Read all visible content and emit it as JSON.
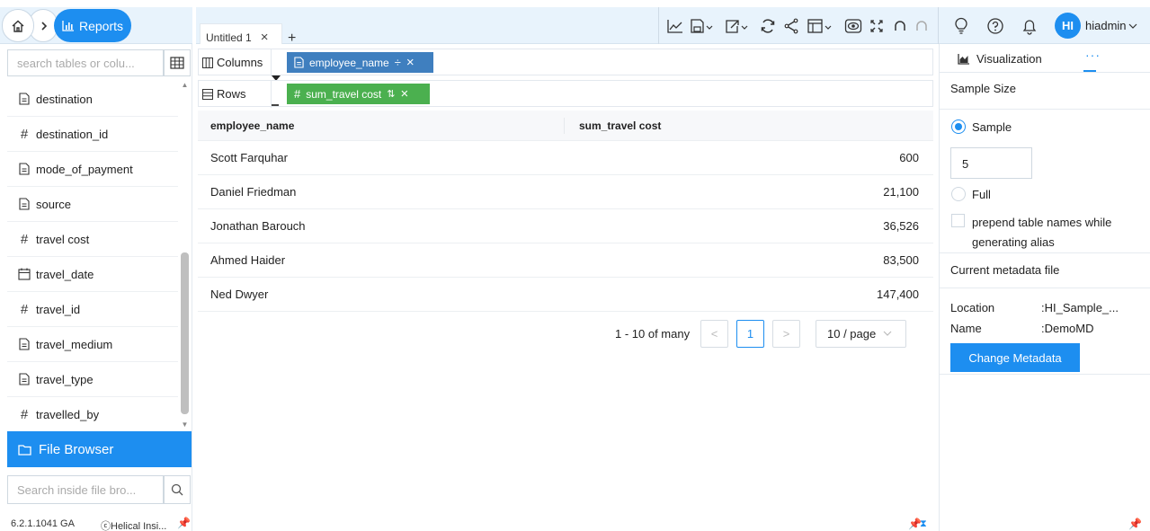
{
  "header": {
    "breadcrumb_reports": "Reports",
    "tab": {
      "title": "Untitled 1",
      "close": "×"
    },
    "add_tab": "+",
    "toolbar_icons": [
      "line-chart-icon",
      "save-dropdown-icon",
      "export-dropdown-icon",
      "refresh-icon",
      "share-icon",
      "layout-dropdown-icon",
      "preview-icon",
      "fullscreen-icon",
      "undo-icon",
      "redo-icon"
    ],
    "user": {
      "initials": "HI",
      "name": "hiadmin"
    }
  },
  "left_panel": {
    "search_placeholder": "search tables or colu...",
    "fields": [
      {
        "icon": "text-icon",
        "name": "destination"
      },
      {
        "icon": "hash-icon",
        "name": "destination_id"
      },
      {
        "icon": "text-icon",
        "name": "mode_of_payment"
      },
      {
        "icon": "text-icon",
        "name": "source"
      },
      {
        "icon": "hash-icon",
        "name": "travel cost"
      },
      {
        "icon": "calendar-icon",
        "name": "travel_date"
      },
      {
        "icon": "hash-icon",
        "name": "travel_id"
      },
      {
        "icon": "text-icon",
        "name": "travel_medium"
      },
      {
        "icon": "text-icon",
        "name": "travel_type"
      },
      {
        "icon": "hash-icon",
        "name": "travelled_by"
      }
    ],
    "file_browser_label": "File Browser",
    "file_search_placeholder": "Search inside file bro...",
    "version": "6.2.1.1041 GA",
    "copyright": "ⓒHelical Insi..."
  },
  "shelves": {
    "columns_label": "Columns",
    "rows_label": "Rows",
    "column_pill": "employee_name",
    "row_pill": "sum_travel cost"
  },
  "table": {
    "headers": [
      "employee_name",
      "sum_travel cost"
    ],
    "rows": [
      {
        "name": "Scott Farquhar",
        "cost": "600"
      },
      {
        "name": "Daniel Friedman",
        "cost": "21,100"
      },
      {
        "name": "Jonathan Barouch",
        "cost": "36,526"
      },
      {
        "name": "Ahmed Haider",
        "cost": "83,500"
      },
      {
        "name": "Ned Dwyer",
        "cost": "147,400"
      }
    ]
  },
  "pagination": {
    "info": "1 - 10 of many",
    "prev": "<",
    "current_page": "1",
    "next": ">",
    "page_size": "10 / page"
  },
  "right_panel": {
    "tab_visualization": "Visualization",
    "tab_more": "···",
    "sample_size_title": "Sample Size",
    "sample_option": "Sample",
    "sample_value": "5",
    "full_option": "Full",
    "prepend_checkbox_label": "prepend table names while generating alias",
    "metadata_title": "Current metadata file",
    "location_key": "Location",
    "location_value": ":HI_Sample_...",
    "name_key": "Name",
    "name_value": ":DemoMD",
    "change_button": "Change Metadata"
  },
  "colors": {
    "accent": "#1d8ef0",
    "pill_blue": "#3f7fbf",
    "pill_green": "#4bb04f",
    "header_bg": "#e8f3fc"
  }
}
